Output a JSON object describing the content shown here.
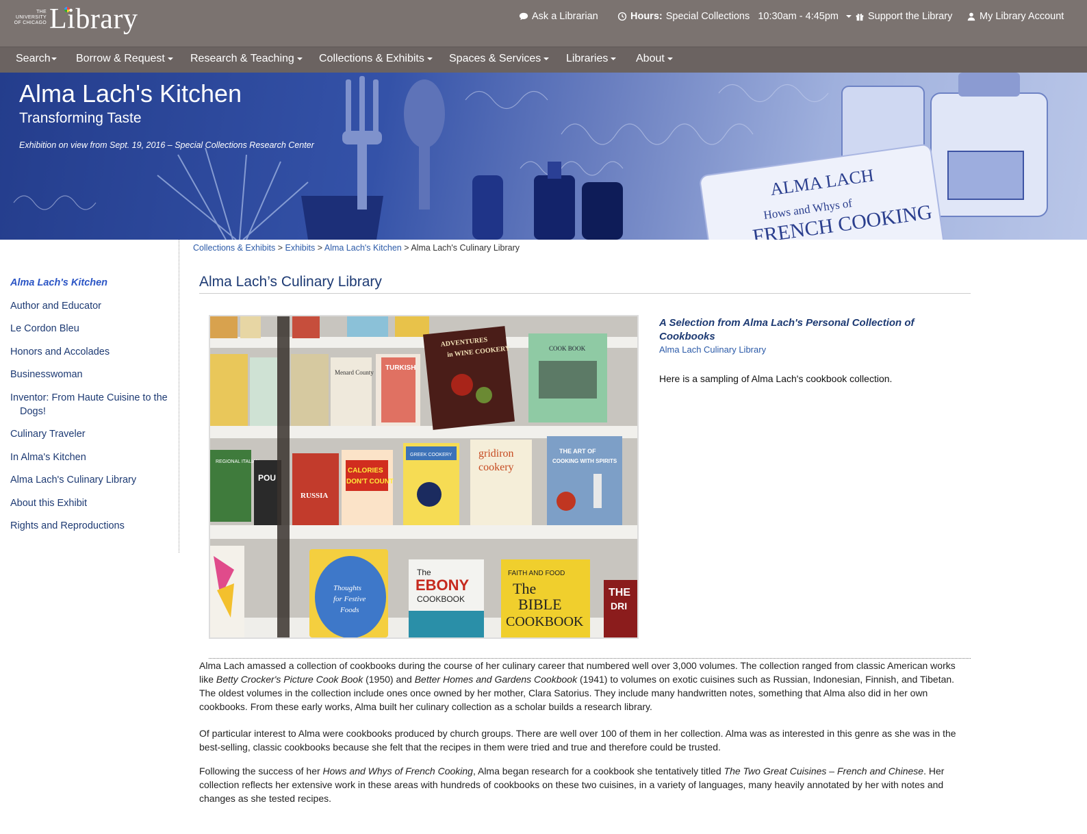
{
  "header": {
    "logo_small": "THE UNIVERSITY OF CHICAGO",
    "logo_word": "Library",
    "ask": "Ask a Librarian",
    "hours_label": "Hours:",
    "hours_value": "Special Collections   10:30am - 4:45pm",
    "support": "Support the Library",
    "account": "My Library Account"
  },
  "nav": {
    "items": [
      "Search",
      "Borrow & Request",
      "Research & Teaching",
      "Collections & Exhibits",
      "Spaces & Services",
      "Libraries",
      "About"
    ]
  },
  "banner": {
    "title": "Alma Lach's Kitchen",
    "subtitle": "Transforming Taste",
    "note": "Exhibition on view from Sept. 19, 2016 – Special Collections Research Center"
  },
  "sidebar": {
    "items": [
      "Alma Lach's Kitchen",
      "Author and Educator",
      "Le Cordon Bleu",
      "Honors and Accolades",
      "Businesswoman",
      "Inventor: From Haute Cuisine to the Dogs!",
      "Culinary Traveler",
      "In Alma's Kitchen",
      "Alma Lach's Culinary Library",
      "About this Exhibit",
      "Rights and Reproductions"
    ]
  },
  "breadcrumb": {
    "items": [
      "Collections & Exhibits",
      "Exhibits",
      "Alma Lach's Kitchen"
    ],
    "current": "Alma Lach's Culinary Library",
    "separator": ">"
  },
  "main": {
    "title": "Alma Lach’s Culinary Library",
    "caption_title": "A Selection from Alma Lach's Personal Collection of Cookbooks",
    "caption_link": "Alma Lach Culinary Library",
    "caption_text": "Here is a sampling of Alma Lach's cookbook collection.",
    "p1": {
      "a": "Alma Lach amassed a collection of cookbooks during the course of her culinary career that numbered well over 3,000 volumes.  The collection ranged from classic American works like ",
      "i1": "Betty Crocker's Picture Cook Book",
      "b": " (1950) and ",
      "i2": "Better Homes and Gardens Cookbook",
      "c": " (1941) to volumes on exotic cuisines such as Russian, Indonesian, Finnish, and Tibetan.  The oldest volumes in the collection include ones once owned by her mother, Clara Satorius.  They include many handwritten notes, something that Alma also did in her own cookbooks.  From these early works, Alma built her culinary collection as a scholar builds a research library."
    },
    "p2": "Of particular interest to Alma were cookbooks produced by church groups.  There are well over 100 of them in her collection.  Alma was as interested in this genre as she was in the best-selling, classic cookbooks because she felt that the recipes in them were tried and true and therefore could be trusted.",
    "p3": {
      "a": "Following the success of her ",
      "i1": "Hows and Whys of French Cooking",
      "b": ", Alma began research for a cookbook she tentatively titled ",
      "i2": "The Two Great Cuisines – French and Chinese",
      "c": ".  Her collection reflects her extensive work in these areas with hundreds of cookbooks on these two cuisines, in a variety of languages, many heavily annotated by her with notes and changes as she tested recipes."
    },
    "photo_books": {
      "row1": [
        "ADVENTURES in WINE COOKERY",
        "COOK BOOK",
        "TURKISH",
        "Menard County"
      ],
      "row2": [
        "CALORIES DON'T COUNT",
        "THE ART OF GREEK COOKERY",
        "gridiron cookery",
        "THE ART OF COOKING WITH SPIRITS",
        "RUSSIA",
        "REGIONAL ITALIAN COOKING"
      ],
      "row3": [
        "The EBONY COOKBOOK",
        "FAITH AND FOOD The BIBLE COOKBOOK",
        "Thoughts for Festive Foods",
        "THE DRI"
      ]
    }
  }
}
